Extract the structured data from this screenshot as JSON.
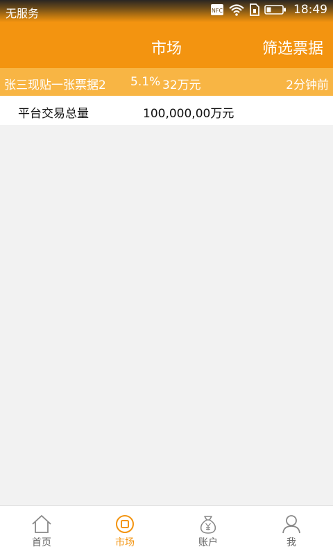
{
  "status_bar": {
    "carrier": "无服务",
    "time": "18:49",
    "nfc_label": "NFC",
    "icons": [
      "nfc-icon",
      "wifi-icon",
      "sim-icon",
      "battery-icon"
    ]
  },
  "header": {
    "title": "市场",
    "filter_label": "筛选票据"
  },
  "ticker": {
    "user_text": "张三现贴一张票据2",
    "rate": "5.1%",
    "amount": "32万元",
    "time": "2分钟前"
  },
  "stats": {
    "label": "平台交易总量",
    "value": "100,000,00万元"
  },
  "tabbar": {
    "items": [
      {
        "label": "首页",
        "icon": "home-icon",
        "active": false
      },
      {
        "label": "市场",
        "icon": "market-icon",
        "active": true
      },
      {
        "label": "账户",
        "icon": "money-bag-icon",
        "active": false
      },
      {
        "label": "我",
        "icon": "person-icon",
        "active": false
      }
    ]
  },
  "colors": {
    "accent": "#f39410",
    "ticker_bg": "#f8b544",
    "background": "#f2f2f2",
    "tab_inactive": "#666666"
  }
}
